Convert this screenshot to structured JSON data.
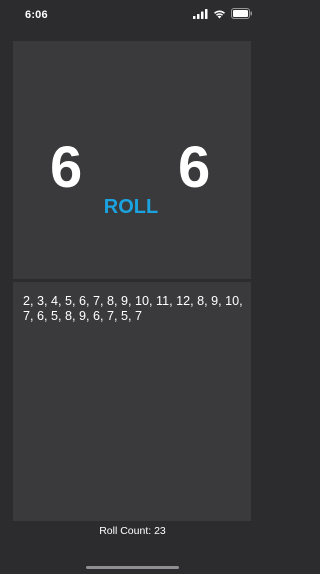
{
  "status_bar": {
    "time": "6:06",
    "icons": [
      "signal-icon",
      "wifi-icon",
      "battery-icon"
    ]
  },
  "dice": {
    "left_value": "6",
    "right_value": "6"
  },
  "roll_button": {
    "label": "ROLL",
    "color": "#1ba3e0"
  },
  "history": {
    "text": "2, 3, 4, 5, 6, 7, 8, 9, 10, 11, 12, 8, 9, 10, 7, 6, 5, 8, 9, 6, 7, 5, 7"
  },
  "footer": {
    "roll_count": "Roll Count: 23"
  },
  "colors": {
    "background": "#2c2c2e",
    "panel": "#3a3a3c",
    "accent": "#1ba3e0"
  }
}
